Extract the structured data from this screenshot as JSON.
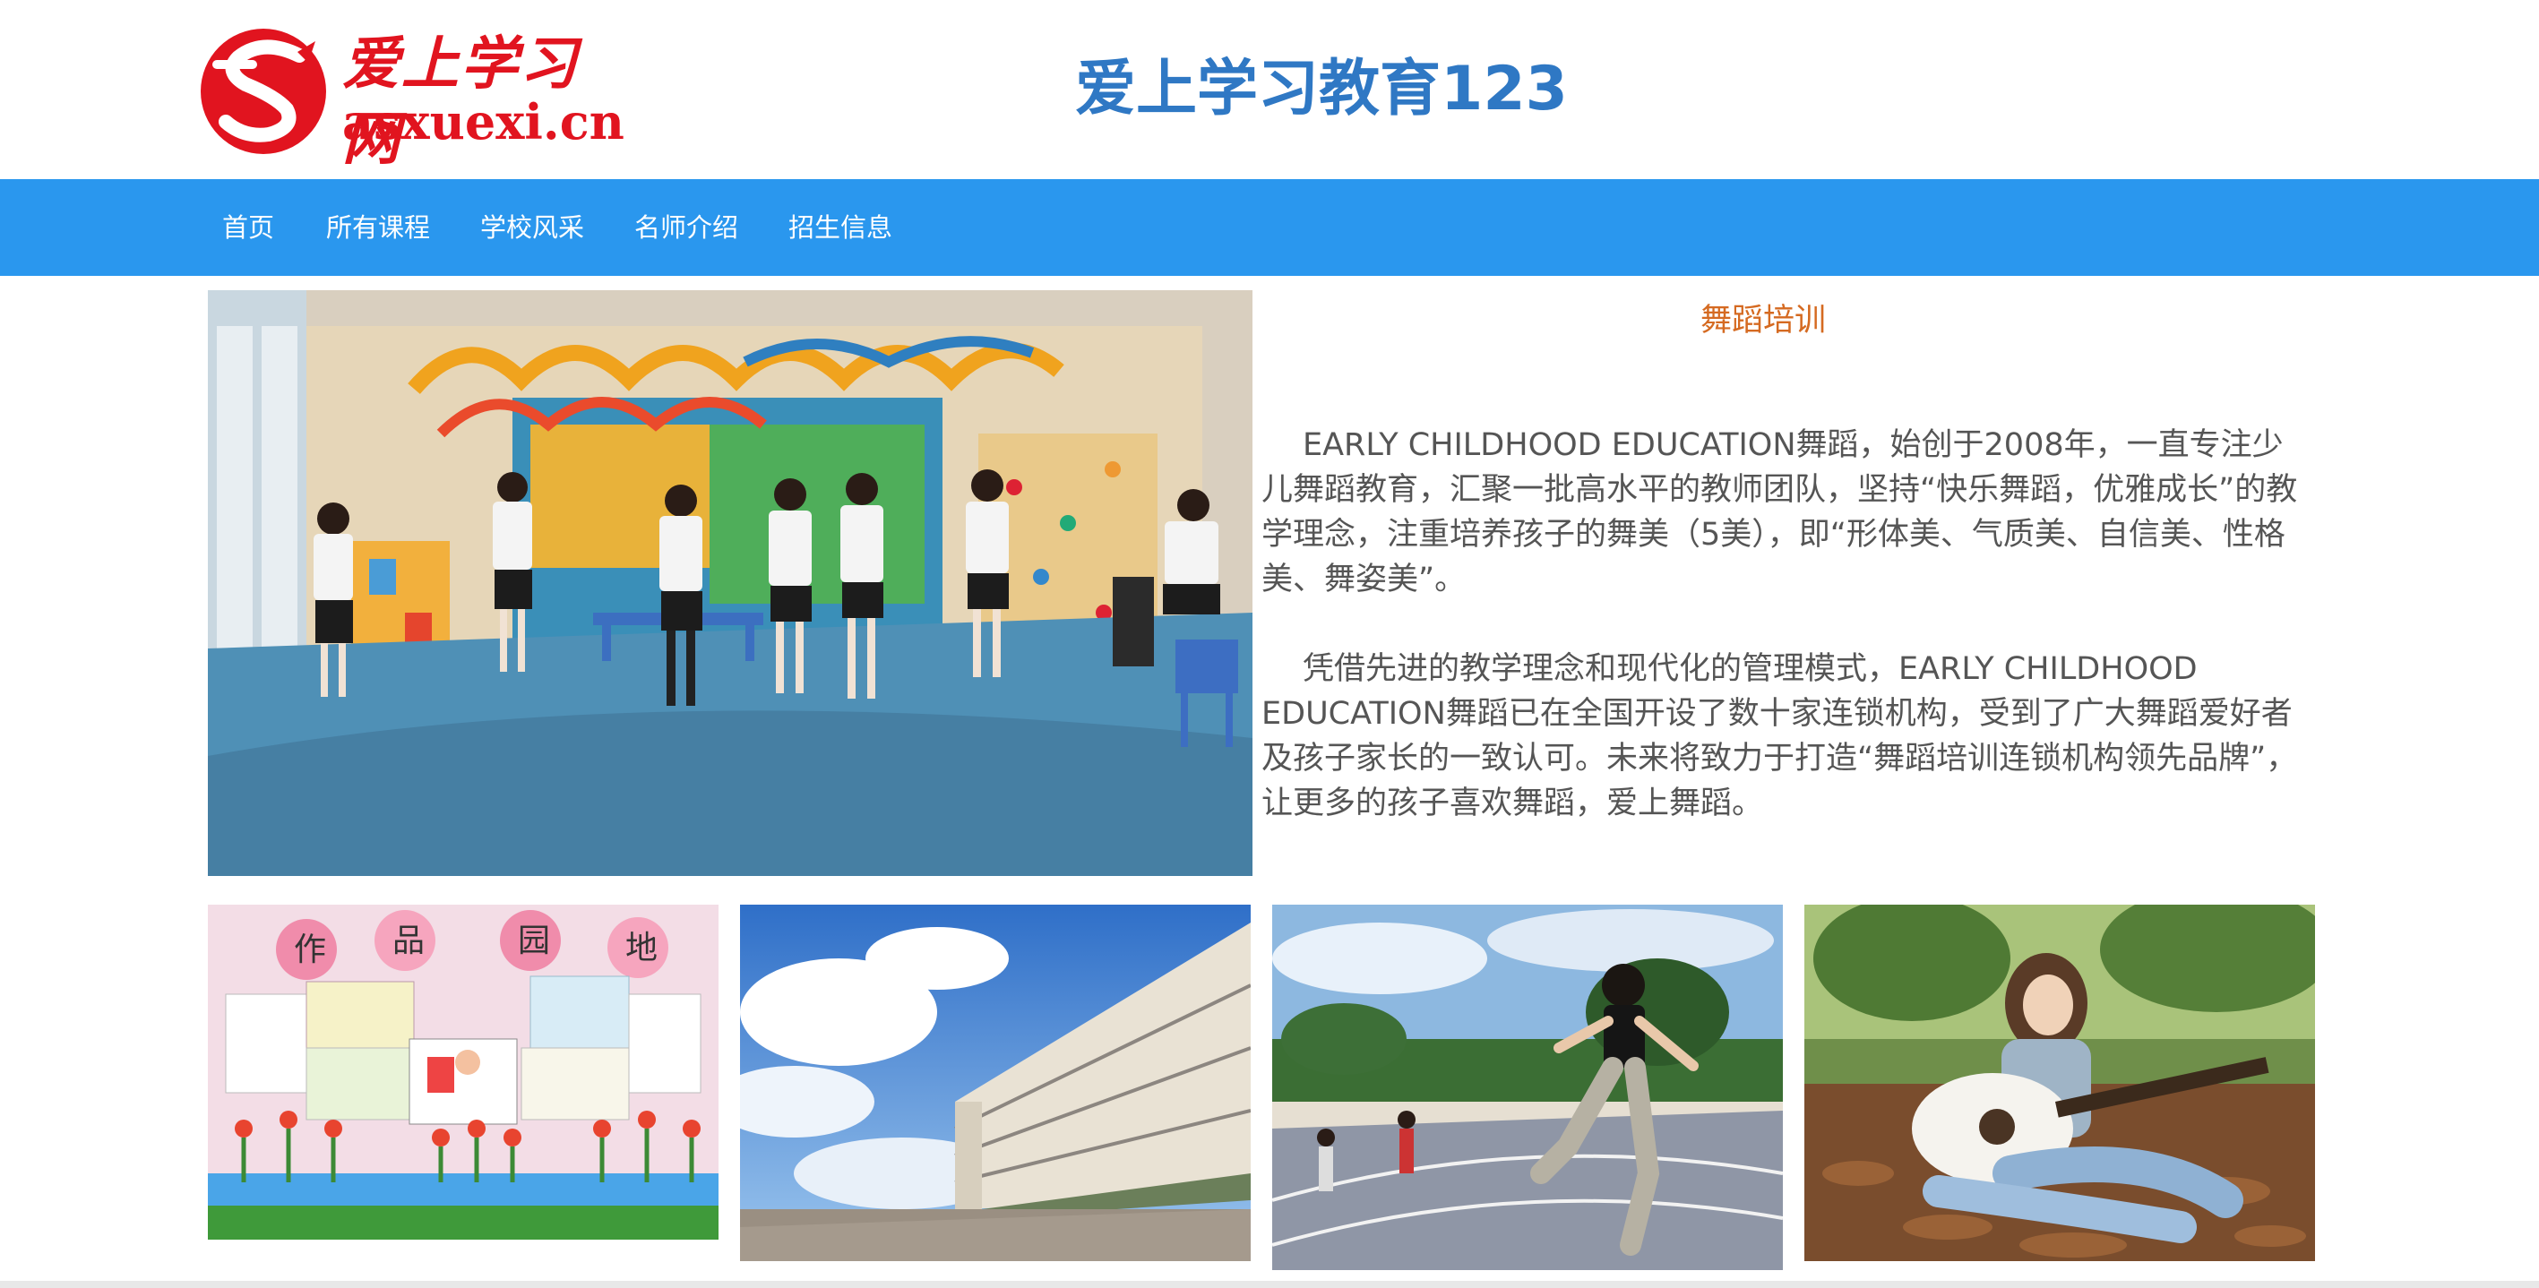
{
  "header": {
    "logo": {
      "cn": "爱上学习网",
      "en": "asxuexi.cn"
    },
    "title": "爱上学习教育123"
  },
  "nav": {
    "items": [
      {
        "label": "首页"
      },
      {
        "label": "所有课程"
      },
      {
        "label": "学校风采"
      },
      {
        "label": "名师介绍"
      },
      {
        "label": "招生信息"
      }
    ]
  },
  "intro": {
    "title": "舞蹈培训",
    "paragraphs": [
      "EARLY CHILDHOOD EDUCATION舞蹈，始创于2008年，一直专注少儿舞蹈教育，汇聚一批高水平的教师团队，坚持“快乐舞蹈，优雅成长”的教学理念，注重培养孩子的舞美（5美），即“形体美、气质美、自信美、性格美、舞姿美”。",
      "凭借先进的教学理念和现代化的管理模式，EARLY CHILDHOOD EDUCATION舞蹈已在全国开设了数十家连锁机构，受到了广大舞蹈爱好者及孩子家长的一致认可。未来将致力于打造“舞蹈培训连锁机构领先品牌”，让更多的孩子喜欢舞蹈，爱上舞蹈。"
    ]
  },
  "gallery": {
    "artwork_sign": [
      "作",
      "品",
      "园",
      "地"
    ]
  },
  "colors": {
    "nav_bg": "#2a97ee",
    "title_blue": "#2f78c4",
    "accent_orange": "#d56a21",
    "logo_red": "#e1141f"
  }
}
